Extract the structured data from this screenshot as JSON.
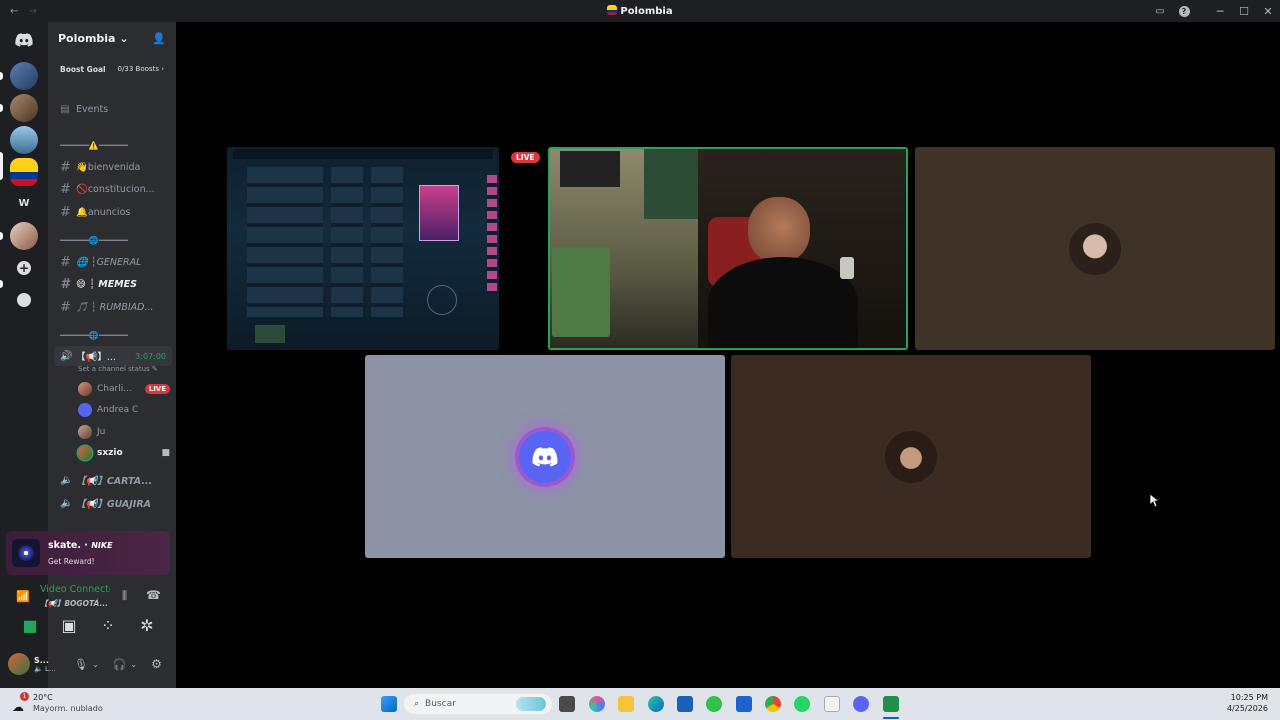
{
  "window": {
    "title": "Polombia"
  },
  "guild": {
    "name": "Polombia",
    "boost_label": "Boost Goal",
    "boost_count": "0/33 Boosts"
  },
  "channels": {
    "events": "Events",
    "divider_1": "━━━━━━⚠️━━━━━━",
    "bienvenida": "👋bienvenida",
    "constitucion": "🚫constitucion...",
    "anuncios": "🔔anuncios",
    "divider_2": "━━━━━━🌐━━━━━━",
    "general": "🌐 ┆GENERAL",
    "memes": "😄 ┆ MEMES",
    "rumbiad": "🎵 ┆ RUMBIAD...",
    "divider_3": "━━━━━━🌐━━━━━━",
    "voice_active": "【📢】...",
    "voice_timer": "3:07:00",
    "channel_status": "Set a channel status",
    "cartagena": "【📢】CARTA...",
    "guajira": "【📢】GUAJIRA"
  },
  "voice_users": [
    {
      "name": "Charli...",
      "live": "LIVE"
    },
    {
      "name": "Andrea C"
    },
    {
      "name": "Ju"
    },
    {
      "name": "sxzio"
    }
  ],
  "promo": {
    "brand": "skate. ·",
    "nike": "NIKE",
    "cta": "Get Reward!"
  },
  "connection": {
    "status": "Video Connected",
    "channel": "【📢】BOGOTÁ..."
  },
  "user": {
    "name": "S...",
    "sub": "🔈 L..."
  },
  "stage": {
    "live_badge": "LIVE"
  },
  "taskbar": {
    "weather_temp": "20°C",
    "weather_desc": "Mayorm. nublado",
    "weather_badge": "1",
    "search_placeholder": "Buscar",
    "time": "10:25 PM",
    "date": "4/25/2026"
  },
  "colors": {
    "discord_blurple": "#5865f2",
    "live_red": "#da373c",
    "speaking_green": "#23a55a",
    "connected_green": "#23a55a"
  }
}
